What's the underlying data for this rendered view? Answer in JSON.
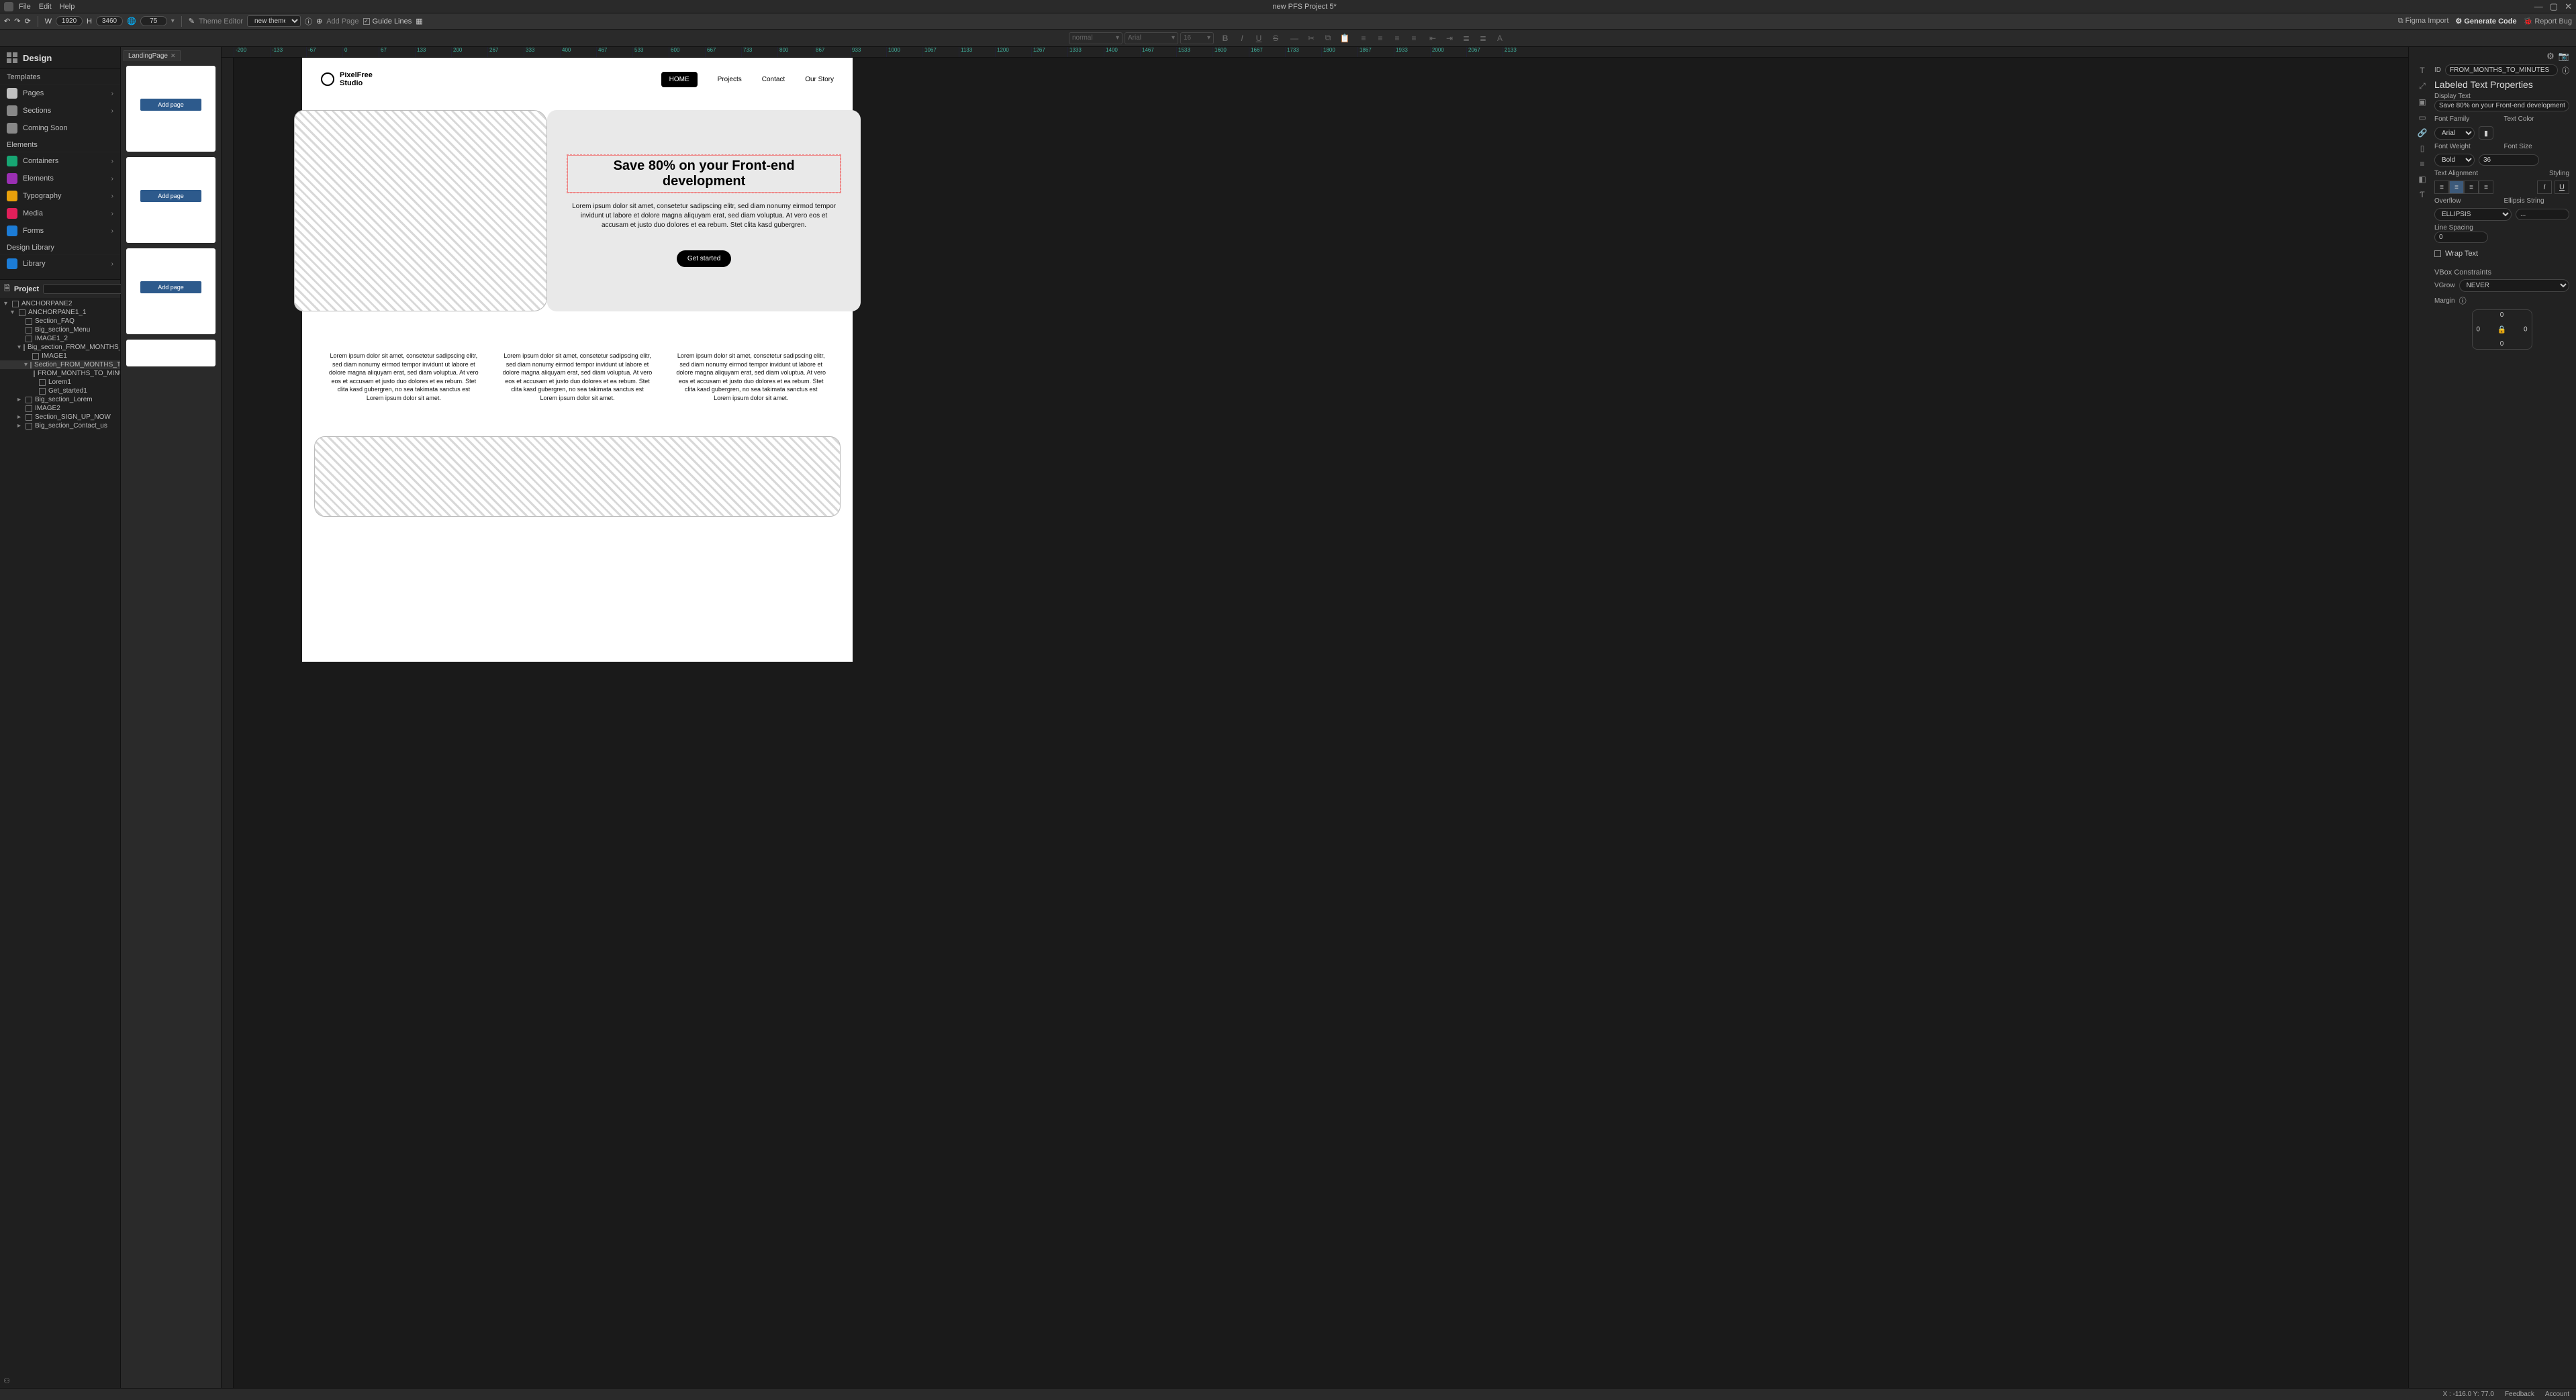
{
  "title": "new PFS Project 5*",
  "menubar": [
    "File",
    "Edit",
    "Help"
  ],
  "window_controls": {
    "min": "—",
    "max": "▢",
    "close": "✕"
  },
  "toolbar": {
    "w_label": "W",
    "w_value": "1920",
    "h_label": "H",
    "h_value": "3460",
    "zoom": "75",
    "theme_editor_label": "Theme Editor",
    "theme_value": "new theme",
    "add_page": "Add Page",
    "guide_lines": "Guide Lines"
  },
  "top_right": {
    "figma": "Figma Import",
    "generate": "Generate Code",
    "report": "Report Bug"
  },
  "format_bar": {
    "combo1": "normal",
    "combo2": "Arial",
    "combo3": "16"
  },
  "left": {
    "design": "Design",
    "templates_h": "Templates",
    "templates": [
      "Pages",
      "Sections",
      "Coming Soon"
    ],
    "elements_h": "Elements",
    "elements": [
      "Containers",
      "Elements",
      "Typography",
      "Media",
      "Forms"
    ],
    "designlib_h": "Design Library",
    "library": "Library"
  },
  "project": {
    "label": "Project",
    "search_placeholder": "",
    "tree": [
      {
        "d": 0,
        "t": "▾",
        "txt": "ANCHORPANE2"
      },
      {
        "d": 1,
        "t": "▾",
        "txt": "ANCHORPANE1_1"
      },
      {
        "d": 2,
        "t": "",
        "txt": "Section_FAQ"
      },
      {
        "d": 2,
        "t": "",
        "txt": "Big_section_Menu"
      },
      {
        "d": 2,
        "t": "",
        "txt": "IMAGE1_2"
      },
      {
        "d": 2,
        "t": "▾",
        "txt": "Big_section_FROM_MONTHS_TO_M"
      },
      {
        "d": 3,
        "t": "",
        "txt": "IMAGE1"
      },
      {
        "d": 3,
        "t": "▾",
        "txt": "Section_FROM_MONTHS_TO_MI",
        "sel": true
      },
      {
        "d": 4,
        "t": "",
        "txt": "FROM_MONTHS_TO_MINUTES"
      },
      {
        "d": 4,
        "t": "",
        "txt": "Lorem1"
      },
      {
        "d": 4,
        "t": "",
        "txt": "Get_started1"
      },
      {
        "d": 2,
        "t": "▸",
        "txt": "Big_section_Lorem"
      },
      {
        "d": 2,
        "t": "",
        "txt": "IMAGE2"
      },
      {
        "d": 2,
        "t": "▸",
        "txt": "Section_SIGN_UP_NOW"
      },
      {
        "d": 2,
        "t": "▸",
        "txt": "Big_section_Contact_us"
      }
    ]
  },
  "tabs": {
    "name": "LandingPage"
  },
  "thumbs": {
    "add_page": "Add page"
  },
  "ruler_ticks": [
    "-200",
    "-133",
    "-67",
    "0",
    "67",
    "133",
    "200",
    "267",
    "333",
    "400",
    "467",
    "533",
    "600",
    "667",
    "733",
    "800",
    "867",
    "933",
    "1000",
    "1067",
    "1133",
    "1200",
    "1267",
    "1333",
    "1400",
    "1467",
    "1533",
    "1600",
    "1667",
    "1733",
    "1800",
    "1867",
    "1933",
    "2000",
    "2067",
    "2133"
  ],
  "canvas": {
    "brand_top": "PixelFree",
    "brand_bot": "Studio",
    "nav": [
      "HOME",
      "Projects",
      "Contact",
      "Our Story"
    ],
    "hero_title": "Save 80% on your Front-end development",
    "hero_p": "Lorem ipsum dolor sit amet, consetetur sadipscing elitr, sed diam nonumy eirmod tempor invidunt ut labore et dolore magna aliquyam erat, sed diam voluptua. At vero eos et accusam et justo duo dolores et ea rebum. Stet clita kasd gubergren.",
    "hero_btn": "Get started",
    "col_p": "Lorem ipsum dolor sit amet, consetetur sadipscing elitr, sed diam nonumy eirmod tempor invidunt ut labore et dolore magna aliquyam erat, sed diam voluptua. At vero eos et accusam et justo duo dolores et ea rebum. Stet clita kasd gubergren, no sea takimata sanctus est Lorem ipsum dolor sit amet."
  },
  "right": {
    "id_label": "ID",
    "id_value": "FROM_MONTHS_TO_MINUTES",
    "panel_title": "Labeled Text Properties",
    "display_text_l": "Display Text",
    "display_text_v": "Save 80% on your Front-end development",
    "font_family_l": "Font Family",
    "font_family_v": "Arial",
    "text_color_l": "Text Color",
    "font_weight_l": "Font Weight",
    "font_weight_v": "Bold",
    "font_size_l": "Font Size",
    "font_size_v": "36",
    "text_align_l": "Text Alignment",
    "styling_l": "Styling",
    "overflow_l": "Overflow",
    "overflow_v": "ELLIPSIS",
    "ellipsis_l": "Ellipsis String",
    "ellipsis_v": "...",
    "line_spacing_l": "Line Spacing",
    "line_spacing_v": "0",
    "wrap_text": "Wrap Text",
    "vbox_h": "VBox Constraints",
    "vgrow_l": "VGrow",
    "vgrow_v": "NEVER",
    "margin_l": "Margin",
    "margin": {
      "t": "0",
      "r": "0",
      "b": "0",
      "l": "0"
    }
  },
  "status": {
    "coords": "X : -116.0 Y: 77.0",
    "feedback": "Feedback",
    "account": "Account"
  }
}
